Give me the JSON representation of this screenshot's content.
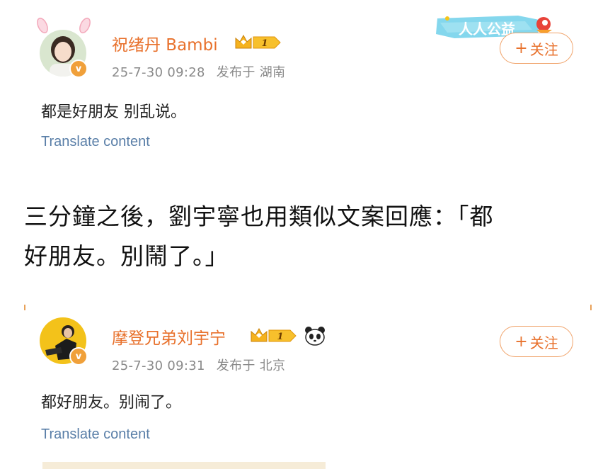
{
  "post1": {
    "username": "祝绪丹 Bambi",
    "timestamp": "25-7-30 09:28",
    "location": "发布于 湖南",
    "content": "都是好朋友 别乱说。",
    "translate": "Translate content",
    "follow": "关注",
    "vip_level": "1",
    "sticker_text": "人人公益"
  },
  "caption": {
    "line1": "三分鐘之後，劉宇寧也用類似文案回應：「都",
    "line2": "好朋友。別鬧了。」"
  },
  "post2": {
    "username": "摩登兄弟刘宇宁",
    "timestamp": "25-7-30 09:31",
    "location": "发布于 北京",
    "content": "都好朋友。别闹了。",
    "translate": "Translate content",
    "follow": "关注",
    "vip_level": "1"
  },
  "colors": {
    "username": "#e8712c",
    "meta": "#8a8a8a",
    "translate": "#5a7fa8",
    "follow_border": "#f0a36a",
    "verified_badge": "#f0a03a"
  }
}
